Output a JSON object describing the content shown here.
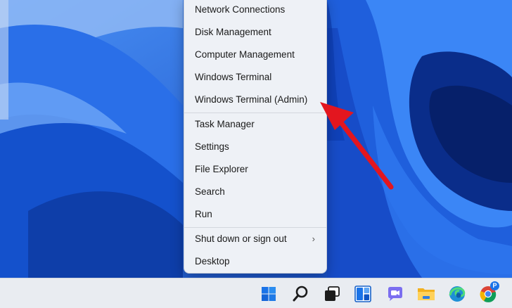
{
  "menu": {
    "items": [
      {
        "label": "Network Connections"
      },
      {
        "label": "Disk Management"
      },
      {
        "label": "Computer Management"
      },
      {
        "label": "Windows Terminal"
      },
      {
        "label": "Windows Terminal (Admin)"
      },
      {
        "label": "Task Manager"
      },
      {
        "label": "Settings"
      },
      {
        "label": "File Explorer"
      },
      {
        "label": "Search"
      },
      {
        "label": "Run"
      },
      {
        "label": "Shut down or sign out",
        "chevron": "›"
      },
      {
        "label": "Desktop"
      }
    ]
  },
  "taskbar": {
    "icons": [
      "windows-start-icon",
      "search-icon",
      "task-view-icon",
      "widgets-icon",
      "teams-chat-icon",
      "file-explorer-icon",
      "edge-browser-icon",
      "chrome-browser-icon"
    ],
    "profile_badge": "P"
  },
  "colors": {
    "menu_bg": "#eef1f6",
    "taskbar_bg": "#e9ecf1",
    "arrow": "#e3161f",
    "wallpaper_blue": "#1b5fd9"
  }
}
